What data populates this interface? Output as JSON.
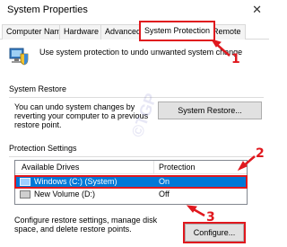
{
  "window": {
    "title": "System Properties",
    "close_glyph": "✕"
  },
  "tabs": [
    {
      "label": "Computer Name"
    },
    {
      "label": "Hardware"
    },
    {
      "label": "Advanced"
    },
    {
      "label": "System Protection"
    },
    {
      "label": "Remote"
    }
  ],
  "intro": {
    "text": "Use system protection to undo unwanted system change",
    "icon": "shield-computer-icon"
  },
  "system_restore": {
    "group_title": "System Restore",
    "description": "You can undo system changes by reverting your computer to a previous restore point.",
    "button_label": "System Restore..."
  },
  "protection_settings": {
    "group_title": "Protection Settings",
    "columns": [
      "Available Drives",
      "Protection"
    ],
    "drives": [
      {
        "name": "Windows (C:) (System)",
        "protection": "On",
        "selected": true,
        "icon": "drive-icon"
      },
      {
        "name": "New Volume (D:)",
        "protection": "Off",
        "selected": false,
        "icon": "drive-icon"
      }
    ],
    "configure_text": "Configure restore settings, manage disk space, and delete restore points.",
    "configure_button_label": "Configure..."
  },
  "annotations": {
    "step1": "1",
    "step2": "2",
    "step3": "3",
    "accent": "#e0181e"
  },
  "watermark": {
    "text": "©TGP"
  },
  "colors": {
    "selection": "#0078d7",
    "highlight": "#e0181e"
  }
}
